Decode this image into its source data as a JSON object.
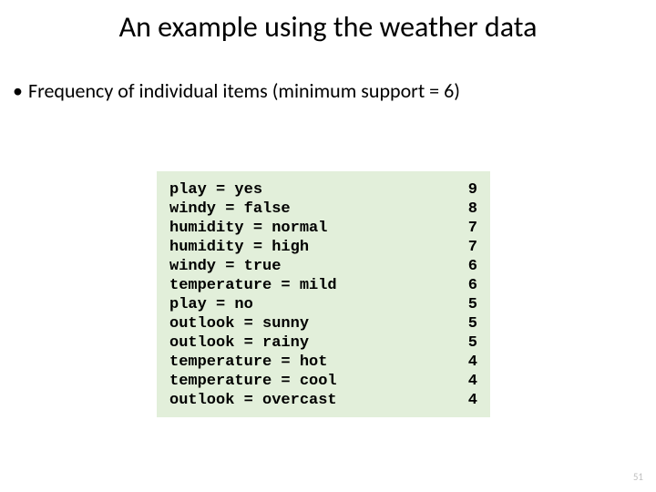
{
  "title": "An example using the weather data",
  "bullet": "Frequency of individual items (minimum support = 6)",
  "items": [
    {
      "label": "play = yes",
      "count": 9
    },
    {
      "label": "windy = false",
      "count": 8
    },
    {
      "label": "humidity = normal",
      "count": 7
    },
    {
      "label": "humidity = high",
      "count": 7
    },
    {
      "label": "windy = true",
      "count": 6
    },
    {
      "label": "temperature = mild",
      "count": 6
    },
    {
      "label": "play = no",
      "count": 5
    },
    {
      "label": "outlook = sunny",
      "count": 5
    },
    {
      "label": "outlook = rainy",
      "count": 5
    },
    {
      "label": "temperature = hot",
      "count": 4
    },
    {
      "label": "temperature = cool",
      "count": 4
    },
    {
      "label": "outlook = overcast",
      "count": 4
    }
  ],
  "page_number": "51"
}
